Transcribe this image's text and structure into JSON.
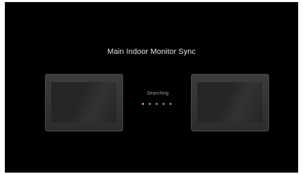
{
  "title": "Main Indoor Monitor Sync",
  "status": "Searching",
  "progress": {
    "total": 5,
    "active_index": 0
  },
  "colors": {
    "background": "#000000",
    "title_text": "#e6e6e6",
    "status_text": "#9a9a9a",
    "dot_active": "#f2a06a",
    "dot_inactive": "#8a8a8a"
  },
  "devices": [
    {
      "name": "indoor-monitor-icon"
    },
    {
      "name": "indoor-monitor-icon"
    }
  ]
}
